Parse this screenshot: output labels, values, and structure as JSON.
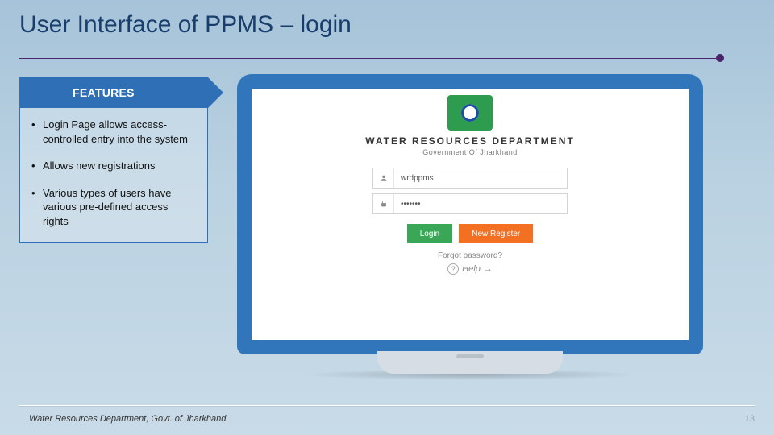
{
  "title": "User Interface of PPMS – login",
  "features": {
    "header": "FEATURES",
    "items": [
      "Login Page allows access-controlled entry into the system",
      "Allows new registrations",
      "Various types of users have various pre-defined access rights"
    ]
  },
  "login": {
    "dept_title": "WATER RESOURCES DEPARTMENT",
    "dept_sub": "Government Of Jharkhand",
    "username_value": "wrdppms",
    "password_value": "•••••••",
    "login_label": "Login",
    "register_label": "New Register",
    "forgot_label": "Forgot password?",
    "help_label": "Help",
    "help_arrow": "→"
  },
  "footer": {
    "org": "Water Resources Department, Govt. of Jharkhand",
    "page": "13"
  }
}
